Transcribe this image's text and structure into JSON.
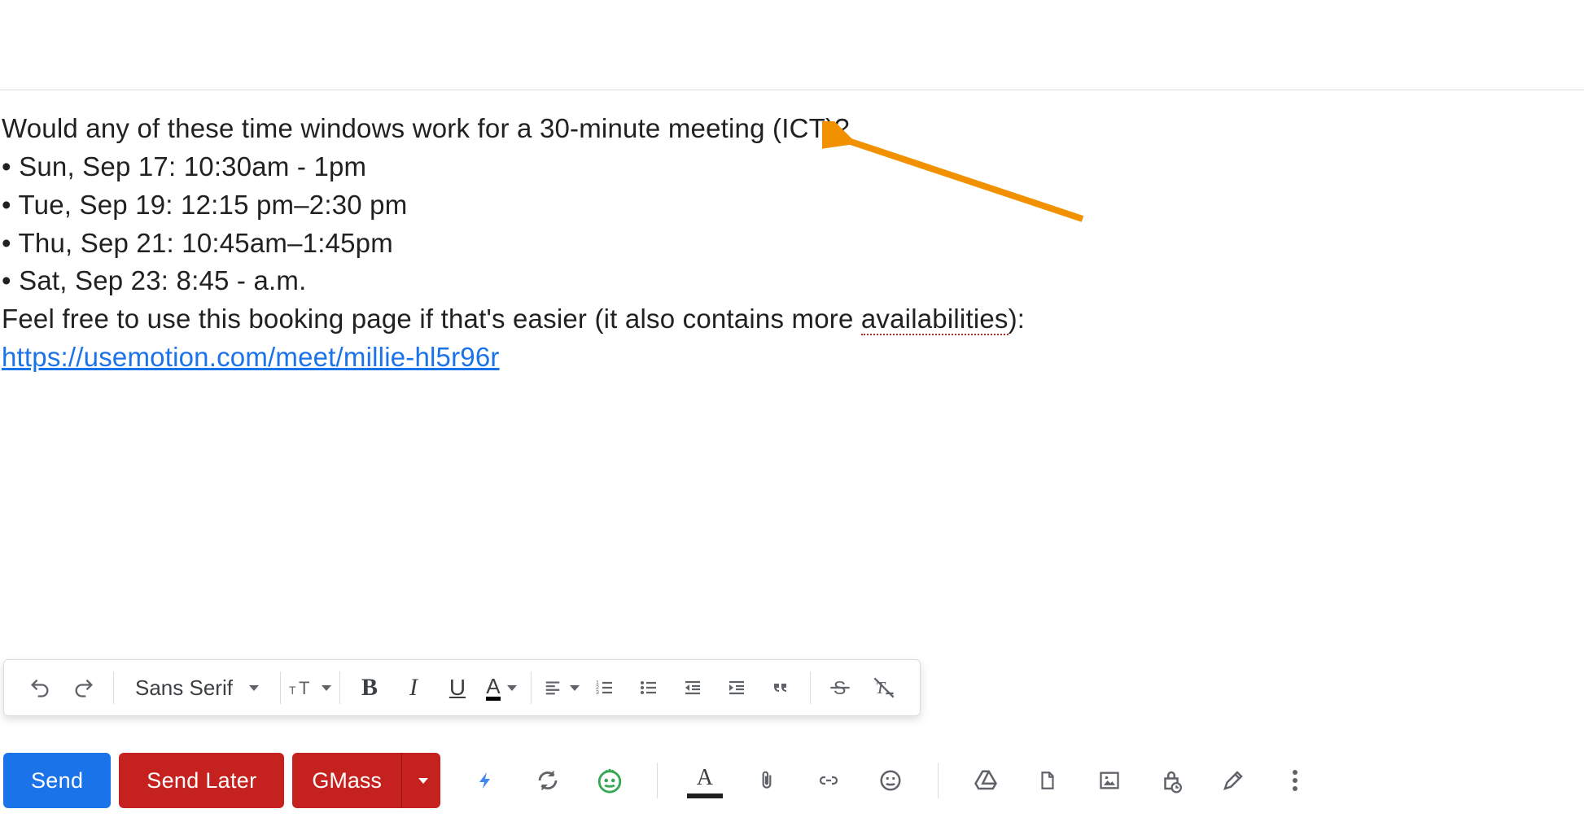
{
  "body": {
    "intro": "Would any of these time windows work for a 30-minute meeting (ICT)?",
    "items": [
      "Sun, Sep 17: 10:30am - 1pm",
      "Tue, Sep 19: 12:15 pm–2:30 pm",
      "Thu, Sep 21: 10:45am–1:45pm",
      "Sat, Sep 23: 8:45 - a.m."
    ],
    "outro_prefix": "Feel free to use this booking page if that's easier (it ",
    "outro_mid": "also contains more ",
    "outro_flagged_word": "availabilities",
    "outro_suffix": "):",
    "link": "https://usemotion.com/meet/millie-hl5r96r"
  },
  "formatting_toolbar": {
    "font_family": "Sans Serif"
  },
  "actions": {
    "send": "Send",
    "send_later": "Send Later",
    "gmass": "GMass"
  },
  "colors": {
    "primary": "#1a73e8",
    "danger": "#c5221f",
    "icon": "#5f6368",
    "annotation_arrow": "#f29100"
  }
}
